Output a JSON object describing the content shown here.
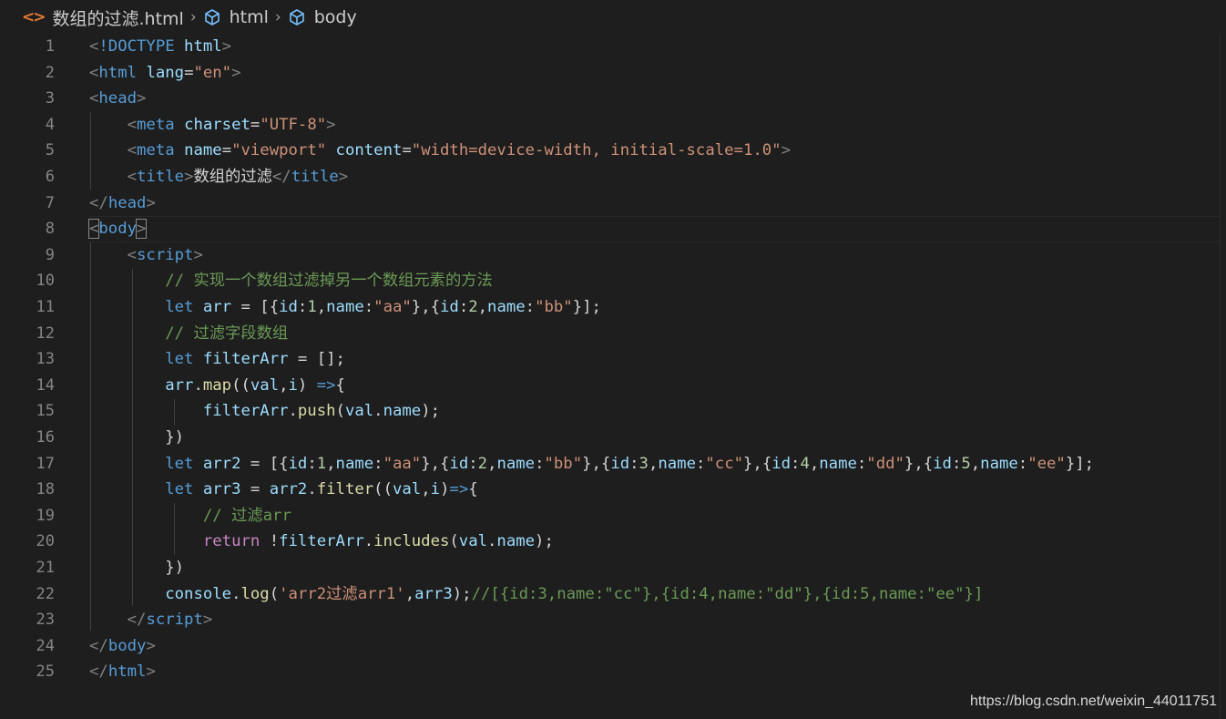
{
  "breadcrumb": {
    "file_icon": "<>",
    "file": "数组的过滤.html",
    "item2": "html",
    "item3": "body"
  },
  "icons": {
    "file_icon": "html-file-icon",
    "element_icon": "cube-symbol-icon"
  },
  "colors": {
    "background": "#1e1e1e",
    "tag": "#569cd6",
    "attribute": "#9cdcfe",
    "string": "#ce9178",
    "comment": "#6a9955",
    "function": "#dcdcaa",
    "control": "#c586c0",
    "number": "#b5cea8"
  },
  "lines": [
    {
      "n": "1",
      "tokens": [
        [
          "punct",
          "<"
        ],
        [
          "tag",
          "!DOCTYPE "
        ],
        [
          "attr",
          "html"
        ],
        [
          "punct",
          ">"
        ]
      ]
    },
    {
      "n": "2",
      "tokens": [
        [
          "punct",
          "<"
        ],
        [
          "tag",
          "html "
        ],
        [
          "attr",
          "lang"
        ],
        [
          "txt",
          "="
        ],
        [
          "str",
          "\"en\""
        ],
        [
          "punct",
          ">"
        ]
      ]
    },
    {
      "n": "3",
      "tokens": [
        [
          "punct",
          "<"
        ],
        [
          "tag",
          "head"
        ],
        [
          "punct",
          ">"
        ]
      ]
    },
    {
      "n": "4",
      "tokens": [
        [
          "txt",
          "    "
        ],
        [
          "punct",
          "<"
        ],
        [
          "tag",
          "meta "
        ],
        [
          "attr",
          "charset"
        ],
        [
          "txt",
          "="
        ],
        [
          "str",
          "\"UTF-8\""
        ],
        [
          "punct",
          ">"
        ]
      ]
    },
    {
      "n": "5",
      "tokens": [
        [
          "txt",
          "    "
        ],
        [
          "punct",
          "<"
        ],
        [
          "tag",
          "meta "
        ],
        [
          "attr",
          "name"
        ],
        [
          "txt",
          "="
        ],
        [
          "str",
          "\"viewport\""
        ],
        [
          "txt",
          " "
        ],
        [
          "attr",
          "content"
        ],
        [
          "txt",
          "="
        ],
        [
          "str",
          "\"width=device-width, initial-scale=1.0\""
        ],
        [
          "punct",
          ">"
        ]
      ]
    },
    {
      "n": "6",
      "tokens": [
        [
          "txt",
          "    "
        ],
        [
          "punct",
          "<"
        ],
        [
          "tag",
          "title"
        ],
        [
          "punct",
          ">"
        ],
        [
          "txt",
          "数组的过滤"
        ],
        [
          "punct",
          "</"
        ],
        [
          "tag",
          "title"
        ],
        [
          "punct",
          ">"
        ]
      ]
    },
    {
      "n": "7",
      "tokens": [
        [
          "punct",
          "</"
        ],
        [
          "tag",
          "head"
        ],
        [
          "punct",
          ">"
        ]
      ]
    },
    {
      "n": "8",
      "tokens": [
        [
          "punctbox",
          "<"
        ],
        [
          "tag",
          "body"
        ],
        [
          "punctbox",
          ">"
        ]
      ]
    },
    {
      "n": "9",
      "tokens": [
        [
          "txt",
          "    "
        ],
        [
          "punct",
          "<"
        ],
        [
          "tag",
          "script"
        ],
        [
          "punct",
          ">"
        ]
      ]
    },
    {
      "n": "10",
      "tokens": [
        [
          "txt",
          "        "
        ],
        [
          "com",
          "// 实现一个数组过滤掉另一个数组元素的方法"
        ]
      ]
    },
    {
      "n": "11",
      "tokens": [
        [
          "txt",
          "        "
        ],
        [
          "kw",
          "let "
        ],
        [
          "var",
          "arr"
        ],
        [
          "txt",
          " = [{"
        ],
        [
          "var",
          "id"
        ],
        [
          "txt",
          ":"
        ],
        [
          "num",
          "1"
        ],
        [
          "txt",
          ","
        ],
        [
          "var",
          "name"
        ],
        [
          "txt",
          ":"
        ],
        [
          "str",
          "\"aa\""
        ],
        [
          "txt",
          "},{"
        ],
        [
          "var",
          "id"
        ],
        [
          "txt",
          ":"
        ],
        [
          "num",
          "2"
        ],
        [
          "txt",
          ","
        ],
        [
          "var",
          "name"
        ],
        [
          "txt",
          ":"
        ],
        [
          "str",
          "\"bb\""
        ],
        [
          "txt",
          "}];"
        ]
      ]
    },
    {
      "n": "12",
      "tokens": [
        [
          "txt",
          "        "
        ],
        [
          "com",
          "// 过滤字段数组"
        ]
      ]
    },
    {
      "n": "13",
      "tokens": [
        [
          "txt",
          "        "
        ],
        [
          "kw",
          "let "
        ],
        [
          "var",
          "filterArr"
        ],
        [
          "txt",
          " = [];"
        ]
      ]
    },
    {
      "n": "14",
      "tokens": [
        [
          "txt",
          "        "
        ],
        [
          "var",
          "arr"
        ],
        [
          "txt",
          "."
        ],
        [
          "fn",
          "map"
        ],
        [
          "txt",
          "(("
        ],
        [
          "var",
          "val"
        ],
        [
          "txt",
          ","
        ],
        [
          "var",
          "i"
        ],
        [
          "txt",
          ") "
        ],
        [
          "kw",
          "=>"
        ],
        [
          "txt",
          "{"
        ]
      ]
    },
    {
      "n": "15",
      "tokens": [
        [
          "txt",
          "            "
        ],
        [
          "var",
          "filterArr"
        ],
        [
          "txt",
          "."
        ],
        [
          "fn",
          "push"
        ],
        [
          "txt",
          "("
        ],
        [
          "var",
          "val"
        ],
        [
          "txt",
          "."
        ],
        [
          "var",
          "name"
        ],
        [
          "txt",
          ");"
        ]
      ]
    },
    {
      "n": "16",
      "tokens": [
        [
          "txt",
          "        })"
        ]
      ]
    },
    {
      "n": "17",
      "tokens": [
        [
          "txt",
          "        "
        ],
        [
          "kw",
          "let "
        ],
        [
          "var",
          "arr2"
        ],
        [
          "txt",
          " = [{"
        ],
        [
          "var",
          "id"
        ],
        [
          "txt",
          ":"
        ],
        [
          "num",
          "1"
        ],
        [
          "txt",
          ","
        ],
        [
          "var",
          "name"
        ],
        [
          "txt",
          ":"
        ],
        [
          "str",
          "\"aa\""
        ],
        [
          "txt",
          "},{"
        ],
        [
          "var",
          "id"
        ],
        [
          "txt",
          ":"
        ],
        [
          "num",
          "2"
        ],
        [
          "txt",
          ","
        ],
        [
          "var",
          "name"
        ],
        [
          "txt",
          ":"
        ],
        [
          "str",
          "\"bb\""
        ],
        [
          "txt",
          "},{"
        ],
        [
          "var",
          "id"
        ],
        [
          "txt",
          ":"
        ],
        [
          "num",
          "3"
        ],
        [
          "txt",
          ","
        ],
        [
          "var",
          "name"
        ],
        [
          "txt",
          ":"
        ],
        [
          "str",
          "\"cc\""
        ],
        [
          "txt",
          "},{"
        ],
        [
          "var",
          "id"
        ],
        [
          "txt",
          ":"
        ],
        [
          "num",
          "4"
        ],
        [
          "txt",
          ","
        ],
        [
          "var",
          "name"
        ],
        [
          "txt",
          ":"
        ],
        [
          "str",
          "\"dd\""
        ],
        [
          "txt",
          "},{"
        ],
        [
          "var",
          "id"
        ],
        [
          "txt",
          ":"
        ],
        [
          "num",
          "5"
        ],
        [
          "txt",
          ","
        ],
        [
          "var",
          "name"
        ],
        [
          "txt",
          ":"
        ],
        [
          "str",
          "\"ee\""
        ],
        [
          "txt",
          "}];"
        ]
      ]
    },
    {
      "n": "18",
      "tokens": [
        [
          "txt",
          "        "
        ],
        [
          "kw",
          "let "
        ],
        [
          "var",
          "arr3"
        ],
        [
          "txt",
          " = "
        ],
        [
          "var",
          "arr2"
        ],
        [
          "txt",
          "."
        ],
        [
          "fn",
          "filter"
        ],
        [
          "txt",
          "(("
        ],
        [
          "var",
          "val"
        ],
        [
          "txt",
          ","
        ],
        [
          "var",
          "i"
        ],
        [
          "txt",
          ")"
        ],
        [
          "kw",
          "=>"
        ],
        [
          "txt",
          "{"
        ]
      ]
    },
    {
      "n": "19",
      "tokens": [
        [
          "txt",
          "            "
        ],
        [
          "com",
          "// 过滤arr"
        ]
      ]
    },
    {
      "n": "20",
      "tokens": [
        [
          "txt",
          "            "
        ],
        [
          "ctl",
          "return "
        ],
        [
          "txt",
          "!"
        ],
        [
          "var",
          "filterArr"
        ],
        [
          "txt",
          "."
        ],
        [
          "fn",
          "includes"
        ],
        [
          "txt",
          "("
        ],
        [
          "var",
          "val"
        ],
        [
          "txt",
          "."
        ],
        [
          "var",
          "name"
        ],
        [
          "txt",
          ");"
        ]
      ]
    },
    {
      "n": "21",
      "tokens": [
        [
          "txt",
          "        })"
        ]
      ]
    },
    {
      "n": "22",
      "tokens": [
        [
          "txt",
          "        "
        ],
        [
          "var",
          "console"
        ],
        [
          "txt",
          "."
        ],
        [
          "fn",
          "log"
        ],
        [
          "txt",
          "("
        ],
        [
          "str",
          "'arr2过滤arr1'"
        ],
        [
          "txt",
          ","
        ],
        [
          "var",
          "arr3"
        ],
        [
          "txt",
          ");"
        ],
        [
          "com",
          "//[{id:3,name:\"cc\"},{id:4,name:\"dd\"},{id:5,name:\"ee\"}]"
        ]
      ]
    },
    {
      "n": "23",
      "tokens": [
        [
          "txt",
          "    "
        ],
        [
          "punct",
          "</"
        ],
        [
          "tag",
          "script"
        ],
        [
          "punct",
          ">"
        ]
      ]
    },
    {
      "n": "24",
      "tokens": [
        [
          "punct",
          "</"
        ],
        [
          "tag",
          "body"
        ],
        [
          "punct",
          ">"
        ]
      ]
    },
    {
      "n": "25",
      "tokens": [
        [
          "punct",
          "</"
        ],
        [
          "tag",
          "html"
        ],
        [
          "punct",
          ">"
        ]
      ]
    }
  ],
  "watermark": "https://blog.csdn.net/weixin_44011751"
}
